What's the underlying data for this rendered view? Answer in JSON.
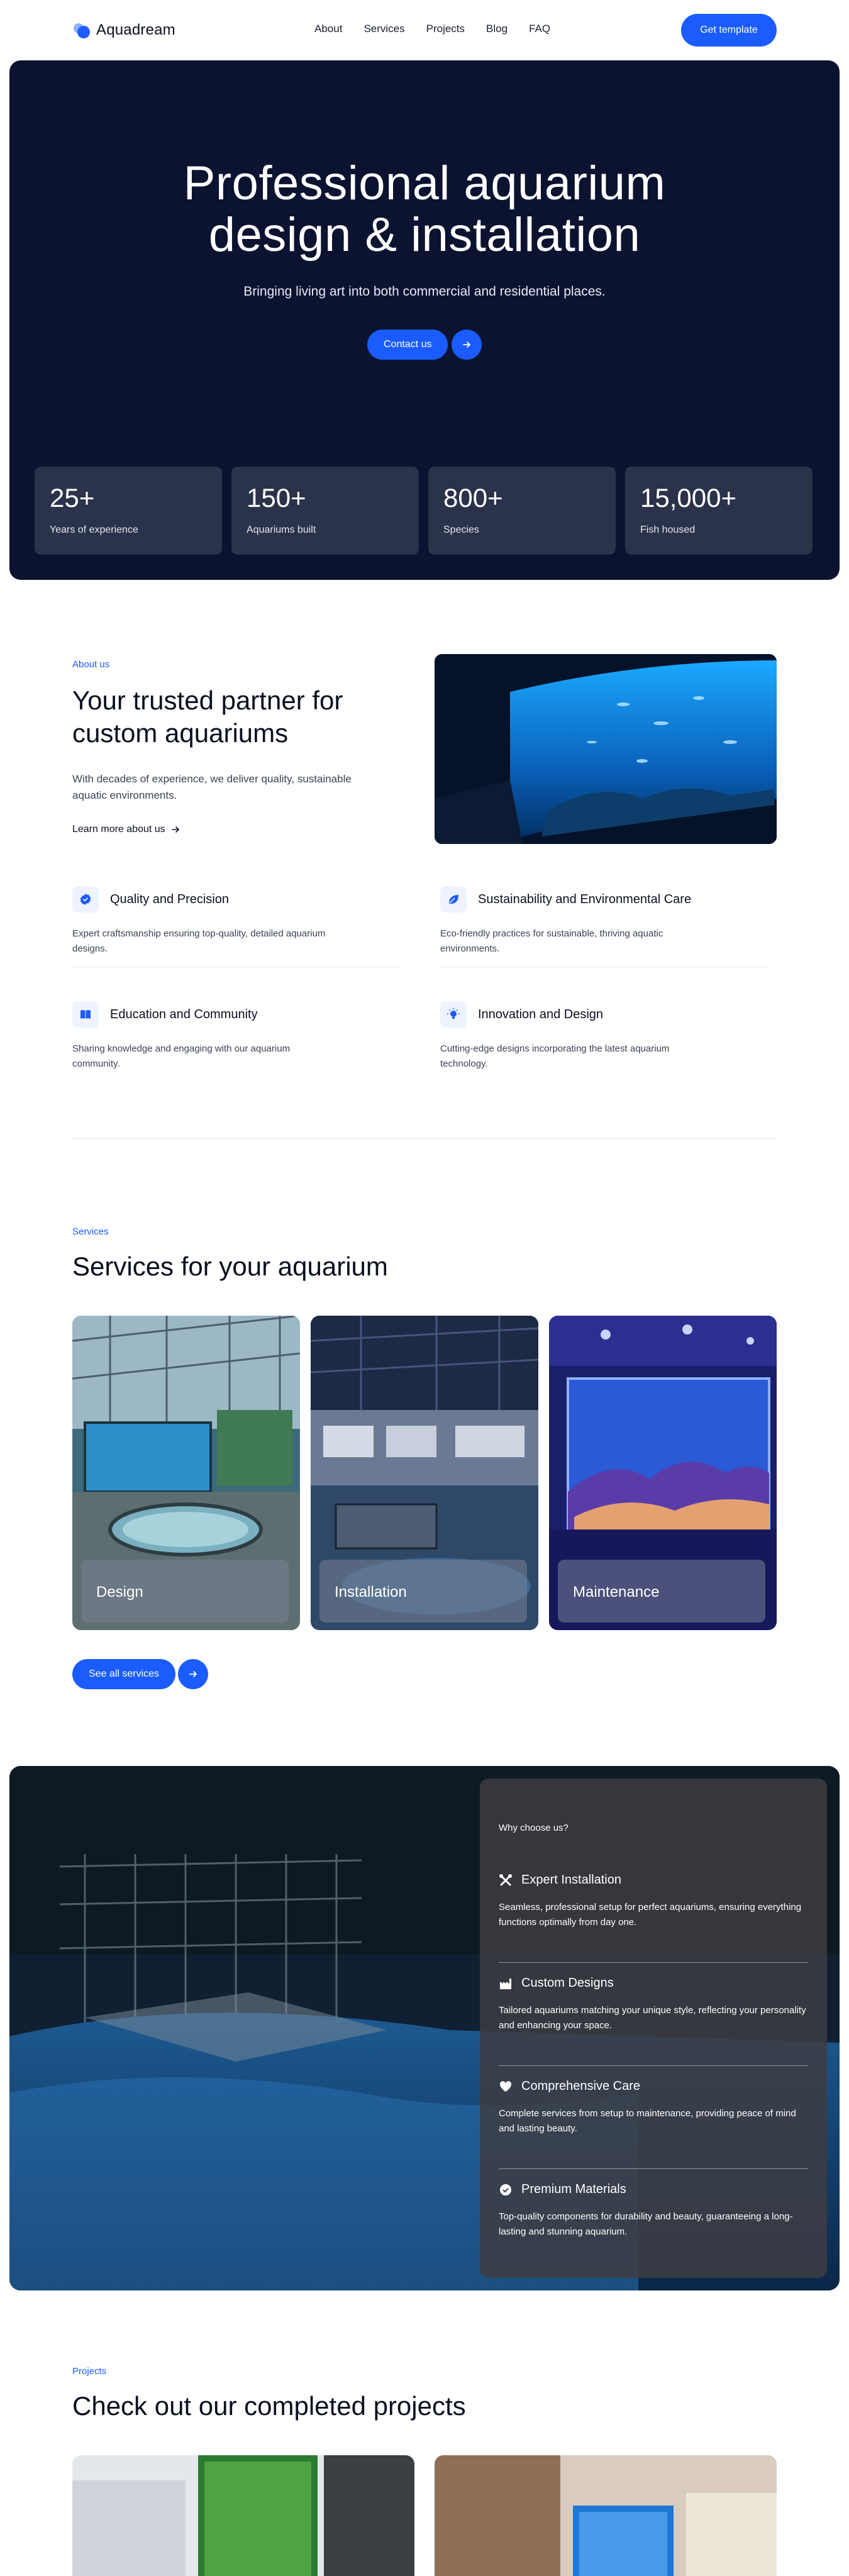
{
  "brand": {
    "name": "Aquadream"
  },
  "nav": {
    "links": [
      "About",
      "Services",
      "Projects",
      "Blog",
      "FAQ"
    ],
    "cta": "Get template"
  },
  "hero": {
    "title_line1": "Professional aquarium",
    "title_line2": "design & installation",
    "subtitle": "Bringing living art into both commercial and residential places.",
    "cta": "Contact us",
    "stats": [
      {
        "value": "25+",
        "label": "Years of experience"
      },
      {
        "value": "150+",
        "label": "Aquariums built"
      },
      {
        "value": "800+",
        "label": "Species"
      },
      {
        "value": "15,000+",
        "label": "Fish housed"
      }
    ]
  },
  "about": {
    "eyebrow": "About us",
    "title": "Your trusted partner for custom aquariums",
    "description": "With decades of experience, we deliver quality, sustainable aquatic environments.",
    "link": "Learn more about us",
    "features": [
      {
        "icon": "badge-check-icon",
        "title": "Quality and Precision",
        "description": "Expert craftsmanship ensuring top-quality, detailed aquarium designs."
      },
      {
        "icon": "leaf-icon",
        "title": "Sustainability and Environmental Care",
        "description": "Eco-friendly practices for sustainable, thriving aquatic environments."
      },
      {
        "icon": "book-icon",
        "title": "Education and Community",
        "description": "Sharing knowledge and engaging with our aquarium community."
      },
      {
        "icon": "lightbulb-icon",
        "title": "Innovation and Design",
        "description": "Cutting-edge designs incorporating the latest aquarium technology."
      }
    ]
  },
  "services": {
    "eyebrow": "Services",
    "title": "Services for your aquarium",
    "cards": [
      "Design",
      "Installation",
      "Maintenance"
    ],
    "cta": "See all services"
  },
  "why": {
    "eyebrow": "Why choose us?",
    "items": [
      {
        "icon": "tools-icon",
        "title": "Expert Installation",
        "description": "Seamless, professional setup for perfect aquariums, ensuring everything functions optimally from day one."
      },
      {
        "icon": "factory-icon",
        "title": "Custom Designs",
        "description": "Tailored aquariums matching your unique style, reflecting your personality and enhancing your space."
      },
      {
        "icon": "heart-icon",
        "title": "Comprehensive Care",
        "description": "Complete services from setup to maintenance, providing peace of mind and lasting beauty."
      },
      {
        "icon": "badge-check-icon",
        "title": "Premium Materials",
        "description": "Top-quality components for durability and beauty, guaranteeing a long-lasting and stunning aquarium."
      }
    ]
  },
  "projects": {
    "eyebrow": "Projects",
    "title": "Check out our completed projects"
  },
  "colors": {
    "accent": "#1a5cff",
    "hero_bg": "#0b1330",
    "stat_card": "#2a3349"
  }
}
